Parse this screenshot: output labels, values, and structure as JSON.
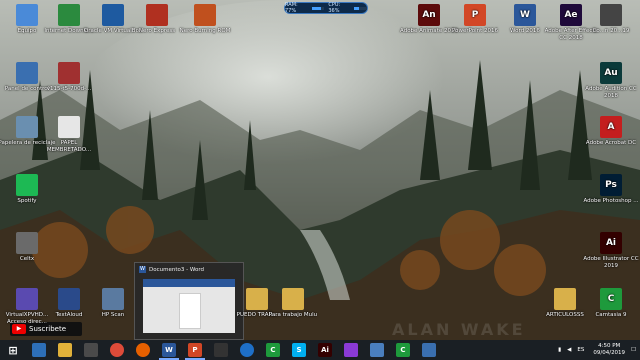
{
  "meter": {
    "ram_label": "RAM: 77%",
    "cpu_label": "CPU: 36%",
    "ram": 0.77,
    "cpu": 0.36
  },
  "watermark": "ALAN WAKE",
  "desktop": {
    "left_col": [
      {
        "label": "Equipo",
        "icon": "computer-icon"
      },
      {
        "label": "Panel de control",
        "icon": "control-panel-icon"
      },
      {
        "label": "Papelera de reciclaje",
        "icon": "recycle-bin-icon"
      },
      {
        "label": "Spotify",
        "icon": "spotify-icon"
      },
      {
        "label": "Celtx",
        "icon": "celtx-icon"
      },
      {
        "label": "VirtualXPVHD... Acceso direc...",
        "icon": "virtual-disk-icon"
      }
    ],
    "col2": [
      {
        "label": "Internet Downlo...",
        "icon": "internet-download-icon"
      },
      {
        "label": "v115-t5-700d-...",
        "icon": "archive-icon"
      },
      {
        "label": "PAPEL MEMBRETADO...",
        "icon": "document-icon"
      },
      {
        "label": "TextAloud",
        "icon": "textaloud-icon"
      }
    ],
    "col3": [
      {
        "label": "Oracle VM VirtualBox",
        "icon": "virtualbox-icon"
      },
      {
        "label": "HP Scan",
        "icon": "scanner-icon"
      }
    ],
    "col4": [
      {
        "label": "Nero Express",
        "icon": "nero-express-icon"
      }
    ],
    "col5": [
      {
        "label": "Nero Burning ROM",
        "icon": "nero-burning-icon"
      }
    ],
    "folders": [
      {
        "label": "PUEDO TRAR...",
        "icon": "folder-icon"
      },
      {
        "label": "Para trabajo Mulu",
        "icon": "folder-icon"
      },
      {
        "label": "ARTICULOSSS",
        "icon": "folder-icon"
      }
    ],
    "top_right": [
      {
        "label": "Adobe Animate 2019",
        "icon": "adobe-animate-icon",
        "abbr": "An",
        "color": "#5c0b0b"
      },
      {
        "label": "PowerPoint 2016",
        "icon": "powerpoint-icon",
        "abbr": "P",
        "color": "#d24726"
      },
      {
        "label": "Word 2016",
        "icon": "word-icon",
        "abbr": "W",
        "color": "#2b579a"
      },
      {
        "label": "Adobe After Effects CC 2018",
        "icon": "after-effects-icon",
        "abbr": "Ae",
        "color": "#1f0a3a"
      },
      {
        "label": "Co...n 20...19",
        "icon": "app-icon",
        "abbr": "",
        "color": "#444"
      }
    ],
    "right_col": [
      {
        "label": "Adobe Audition CC 2018",
        "icon": "audition-icon",
        "abbr": "Au",
        "color": "#0b3a3a"
      },
      {
        "label": "Adobe Acrobat DC",
        "icon": "acrobat-icon",
        "abbr": "A",
        "color": "#c41e1e"
      },
      {
        "label": "Adobe Photoshop ...",
        "icon": "photoshop-icon",
        "abbr": "Ps",
        "color": "#001d34"
      },
      {
        "label": "Adobe Illustrator CC 2019",
        "icon": "illustrator-icon",
        "abbr": "Ai",
        "color": "#330000"
      },
      {
        "label": "Camtasia 9",
        "icon": "camtasia-icon",
        "abbr": "C",
        "color": "#1e9a3c"
      }
    ]
  },
  "preview": {
    "title": "Documento3 - Word"
  },
  "subscribe": {
    "label": "Suscribete"
  },
  "taskbar": {
    "apps": [
      {
        "name": "start-icon",
        "abbr": "",
        "color": "#1a1f24"
      },
      {
        "name": "monitor-icon",
        "abbr": "",
        "color": "#2d6fb8"
      },
      {
        "name": "file-explorer-icon",
        "abbr": "",
        "color": "#e0b13a"
      },
      {
        "name": "store-icon",
        "abbr": "",
        "color": "#4a4a4a"
      },
      {
        "name": "chrome-icon",
        "abbr": "",
        "color": "#dd4b39"
      },
      {
        "name": "firefox-icon",
        "abbr": "",
        "color": "#e66000"
      },
      {
        "name": "word-taskbar-icon",
        "abbr": "W",
        "color": "#2b579a"
      },
      {
        "name": "powerpoint-taskbar-icon",
        "abbr": "P",
        "color": "#d24726"
      },
      {
        "name": "inkscape-icon",
        "abbr": "",
        "color": "#333"
      },
      {
        "name": "sync-icon",
        "abbr": "",
        "color": "#1e6fc7"
      },
      {
        "name": "camtasia-taskbar-icon",
        "abbr": "C",
        "color": "#1e9a3c"
      },
      {
        "name": "skype-icon",
        "abbr": "S",
        "color": "#00aff0"
      },
      {
        "name": "illustrator-taskbar-icon",
        "abbr": "Ai",
        "color": "#330000"
      },
      {
        "name": "media-icon",
        "abbr": "",
        "color": "#8a3ad6"
      },
      {
        "name": "files-icon",
        "abbr": "",
        "color": "#4a7fbf"
      },
      {
        "name": "camtasia-recorder-icon",
        "abbr": "C",
        "color": "#1e9a3c"
      },
      {
        "name": "mail-icon",
        "abbr": "",
        "color": "#3a6fb0"
      }
    ],
    "lang": "ES",
    "time": "4:50 PM",
    "date": "09/04/2019"
  }
}
